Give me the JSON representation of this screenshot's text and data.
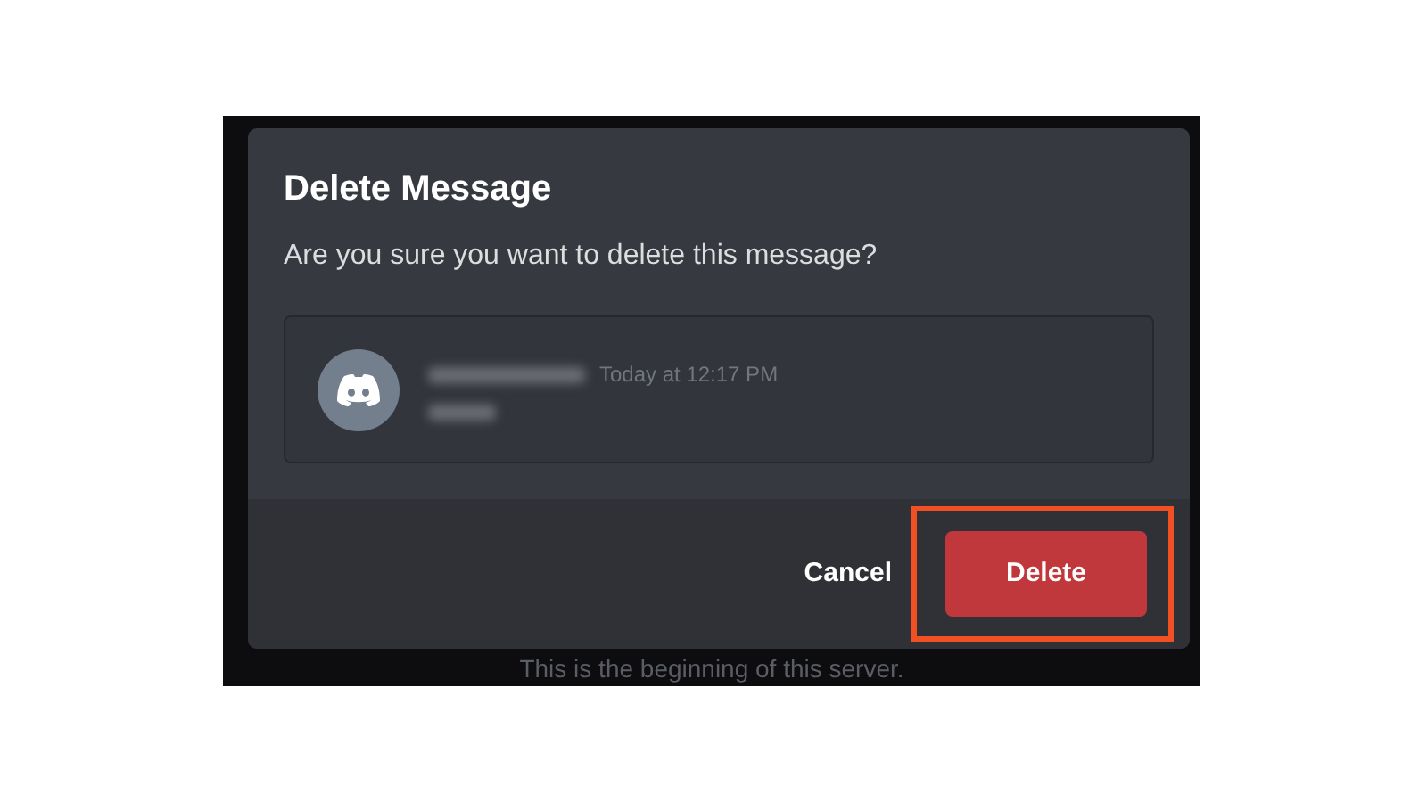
{
  "background_text": "This is the beginning of this server.",
  "dialog": {
    "title": "Delete Message",
    "prompt": "Are you sure you want to delete this message?",
    "message": {
      "timestamp": "Today at 12:17 PM"
    },
    "buttons": [
      {
        "label": "Cancel",
        "kind": "link",
        "highlighted": false
      },
      {
        "label": "Delete",
        "kind": "danger",
        "highlighted": true
      }
    ]
  }
}
